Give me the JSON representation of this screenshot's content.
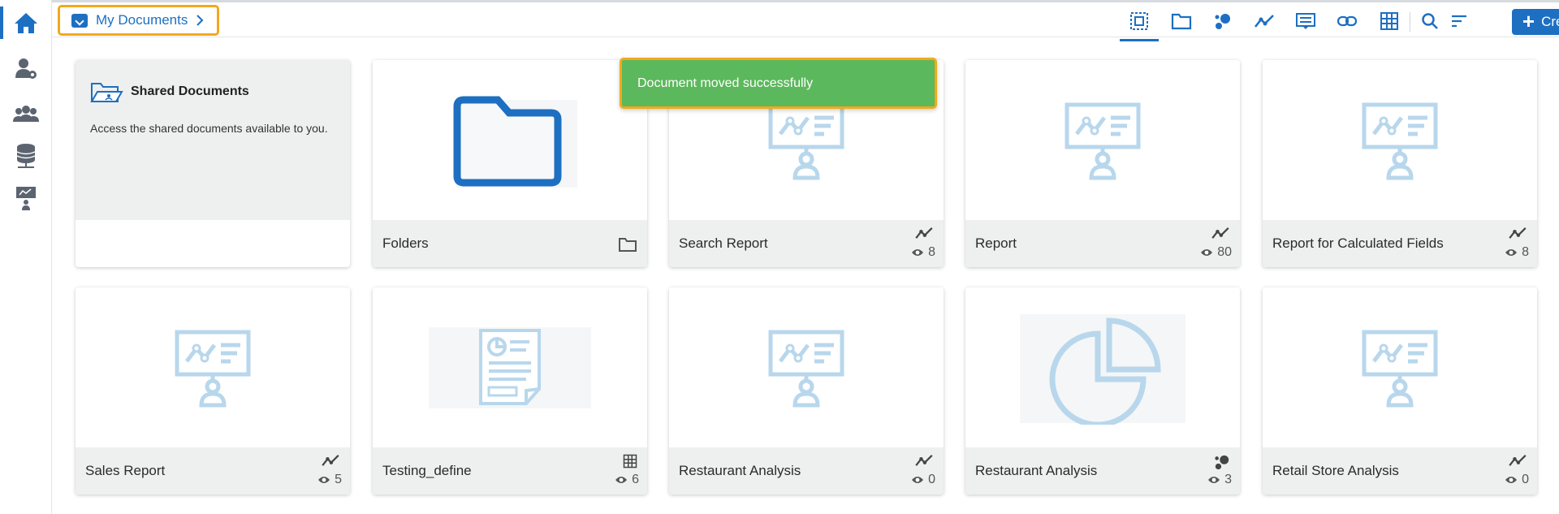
{
  "breadcrumb": {
    "label": "My Documents"
  },
  "sidebar": {
    "items": [
      {
        "icon": "home-icon",
        "active": true
      },
      {
        "icon": "user-settings-icon"
      },
      {
        "icon": "users-group-icon"
      },
      {
        "icon": "database-icon"
      },
      {
        "icon": "presentation-user-icon"
      }
    ]
  },
  "toolbar": {
    "icons": [
      "select-all-icon",
      "folder-icon",
      "bubble-chart-icon",
      "trend-line-icon",
      "story-icon",
      "link-icon",
      "grid-table-icon",
      "search-icon",
      "sort-icon"
    ],
    "create_label": "Create"
  },
  "toast": {
    "message": "Document moved successfully"
  },
  "shared": {
    "title": "Shared Documents",
    "description": "Access the shared documents available to you."
  },
  "cards": [
    {
      "title": "Folders",
      "type": "folder"
    },
    {
      "title": "Search Report",
      "type": "report",
      "views": "8"
    },
    {
      "title": "Report",
      "type": "report",
      "views": "80"
    },
    {
      "title": "Report for Calculated Fields",
      "type": "report",
      "views": "8"
    },
    {
      "title": "Sales Report",
      "type": "report",
      "views": "5"
    },
    {
      "title": "Testing_define",
      "type": "table",
      "views": "6"
    },
    {
      "title": "Restaurant Analysis",
      "type": "report",
      "views": "0"
    },
    {
      "title": "Restaurant Analysis",
      "type": "pie",
      "views": "3"
    },
    {
      "title": "Retail Store Analysis",
      "type": "report",
      "views": "0"
    }
  ],
  "colors": {
    "accent": "#1d6fc2",
    "toast": "#5cb85c",
    "highlight": "#f2a91c",
    "thumb_icon": "#b8d7ec"
  }
}
